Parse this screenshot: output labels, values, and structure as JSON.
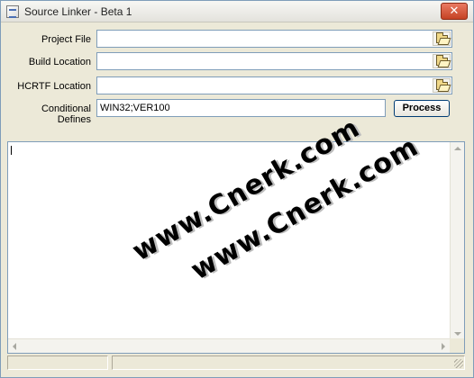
{
  "window": {
    "title": "Source Linker - Beta 1",
    "close_symbol": "✕"
  },
  "form": {
    "project_file": {
      "label": "Project File",
      "value": ""
    },
    "build_location": {
      "label": "Build Location",
      "value": ""
    },
    "hcrtf_location": {
      "label": "HCRTF Location",
      "value": ""
    },
    "conditional_defines": {
      "label": "Conditional Defines",
      "value": "WIN32;VER100"
    },
    "process_label": "Process"
  },
  "output": {
    "text": ""
  },
  "watermarks": [
    "www.Cnerk.com",
    "www.Cnerk.com"
  ],
  "status": {
    "panel1": "",
    "panel2": ""
  },
  "icons": {
    "app": "app-window-icon",
    "browse": "open-folder-icon",
    "close": "close-icon"
  },
  "colors": {
    "window_bg": "#ece9d8",
    "field_border": "#7f9db9",
    "close_button": "#c54224",
    "button_border": "#003c74"
  }
}
